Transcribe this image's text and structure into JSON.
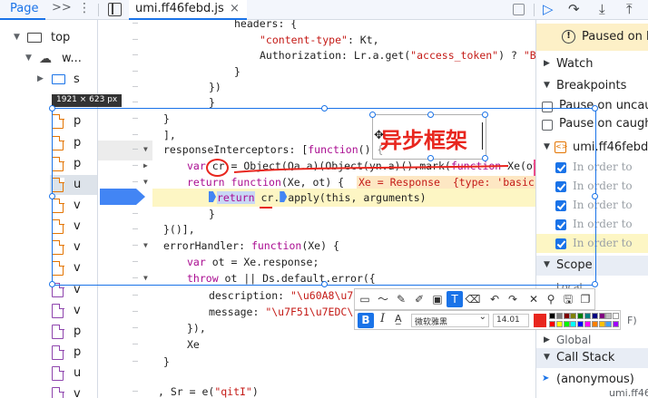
{
  "topbar": {
    "page_tab": "Page",
    "more_glyph": ">>",
    "kebab_glyph": "⋮",
    "file_tab": "umi.ff46febd.js",
    "close_glyph": "×"
  },
  "tree": {
    "top_label": "top",
    "origin_label": "w...",
    "folder_label": "s",
    "files": [
      "p",
      "p",
      "p",
      "u",
      "v",
      "v",
      "v",
      "v",
      "v",
      "v",
      "p",
      "p",
      "u",
      "v"
    ]
  },
  "code": {
    "l1": "headers: {",
    "l2k": "\"content-type\"",
    "l2v": ": Kt,",
    "l3a": "Authorization: Lr.a.get(",
    "l3b": "\"access_token\"",
    "l3c": ") ? ",
    "l3d": "\"Bear",
    "l4": "}",
    "l5": "})",
    "l6": "}",
    "l7": "}",
    "l8": "],",
    "l9a": "responseInterceptors: [",
    "l9b": "function",
    "l9c": "() {",
    "l10a": "var",
    "l10b": "cr",
    "l10c": " = Object(Qa.a)(Object(yn.a)().mark(",
    "l10d": "function",
    "l10e": " Xe(ot, F",
    "l11a": "return",
    "l11b": "function",
    "l11c": "(Xe, ot) {  ",
    "l11d": "Xe = Response  {type: 'basic',",
    "l12a": "return",
    "l12b": " cr.",
    "l12c": "apply(this, arguments)",
    "l13": "}",
    "l14": "}()],",
    "l15a": "errorHandler: ",
    "l15b": "function",
    "l15c": "(Xe) {",
    "l16a": "var",
    "l16b": " ot = Xe.response;",
    "l17a": "throw",
    "l17b": " ot || Ds.default.error({",
    "l18a": "description: ",
    "l18b": "\"\\u60A8\\u768",
    "l19a": "message: ",
    "l19b": "\"\\u7F51\\u7EDC\\u5",
    "l20": "}),",
    "l21": "Xe",
    "l22": "}",
    "l23a": ", Sr = e(",
    "l23b": "\"qitI\"",
    "l23c": ")"
  },
  "sidebar": {
    "paused_text": "Paused on b",
    "watch": "Watch",
    "breakpoints": "Breakpoints",
    "pause_uncaught": "Pause on uncau",
    "pause_caught": "Pause on caught",
    "bp_file": "umi.ff46febd.js",
    "bp_lines": [
      "In order to",
      "In order to",
      "In order to",
      "In order to",
      "In order to"
    ],
    "scope": "Scope",
    "local": "Local",
    "f_label": "F)",
    "global": "Global",
    "call_stack": "Call Stack",
    "anon": "(anonymous)",
    "anon_file": "umi.ff46fe"
  },
  "overlay": {
    "size_tip": "1921 × 623  px",
    "note_text": "异步框架",
    "font_name": "微软雅黑",
    "font_size": "14.01",
    "current_color": "#e8261e",
    "palette": [
      "#000000",
      "#808080",
      "#800000",
      "#808000",
      "#008000",
      "#008080",
      "#000080",
      "#800080",
      "#c0c0c0",
      "#ffffff",
      "#ff0000",
      "#ffff00",
      "#00ff00",
      "#00ffff",
      "#0000ff",
      "#ff00ff",
      "#ff8000",
      "#ffc000",
      "#40a0ff",
      "#a000ff"
    ]
  },
  "colors": {
    "accent": "#1a73e8",
    "annotation_red": "#e8261e",
    "paused_bg": "#fdf0c7",
    "highlight_line": "#fdf6c4"
  }
}
